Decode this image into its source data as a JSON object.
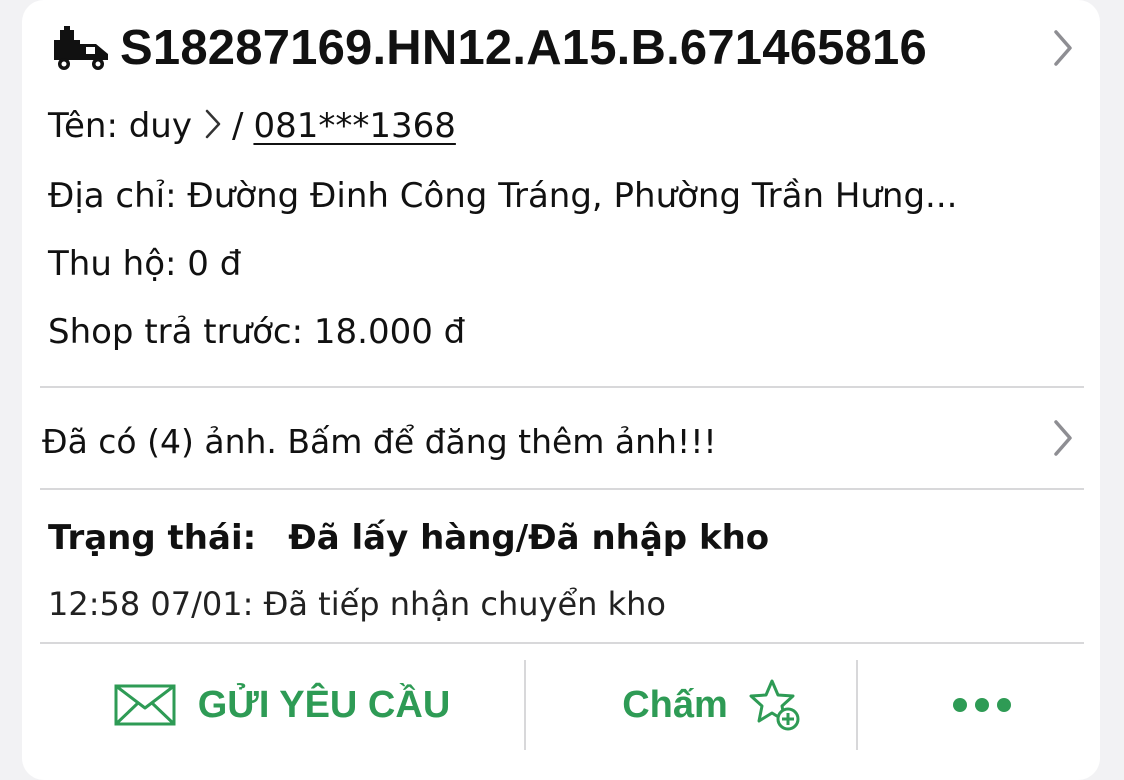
{
  "order": {
    "code": "S18287169.HN12.A15.B.671465816",
    "name_label": "Tên: duy",
    "separator": "/",
    "phone": "081***1368",
    "address": "Địa chỉ: Đường Đinh Công Tráng, Phường Trần Hưng...",
    "cod": "Thu hộ: 0 đ",
    "prepaid": "Shop trả trước: 18.000 đ"
  },
  "photos": {
    "text": "Đã có (4) ảnh. Bấm để đăng thêm ảnh!!!"
  },
  "status": {
    "label": "Trạng thái:",
    "value": "Đã lấy hàng/Đã nhập kho",
    "event": "12:58 07/01: Đã tiếp nhận chuyển kho"
  },
  "actions": {
    "send_request": "GỬI YÊU CẦU",
    "rate": "Chấm",
    "more": "more"
  },
  "colors": {
    "accent": "#2e9b55",
    "text": "#111111",
    "divider": "#d8d8da",
    "chevron": "#8e8e93"
  },
  "icons": [
    "delivery-truck-icon",
    "chevron-right-icon",
    "envelope-icon",
    "star-plus-icon",
    "more-dots-icon"
  ]
}
